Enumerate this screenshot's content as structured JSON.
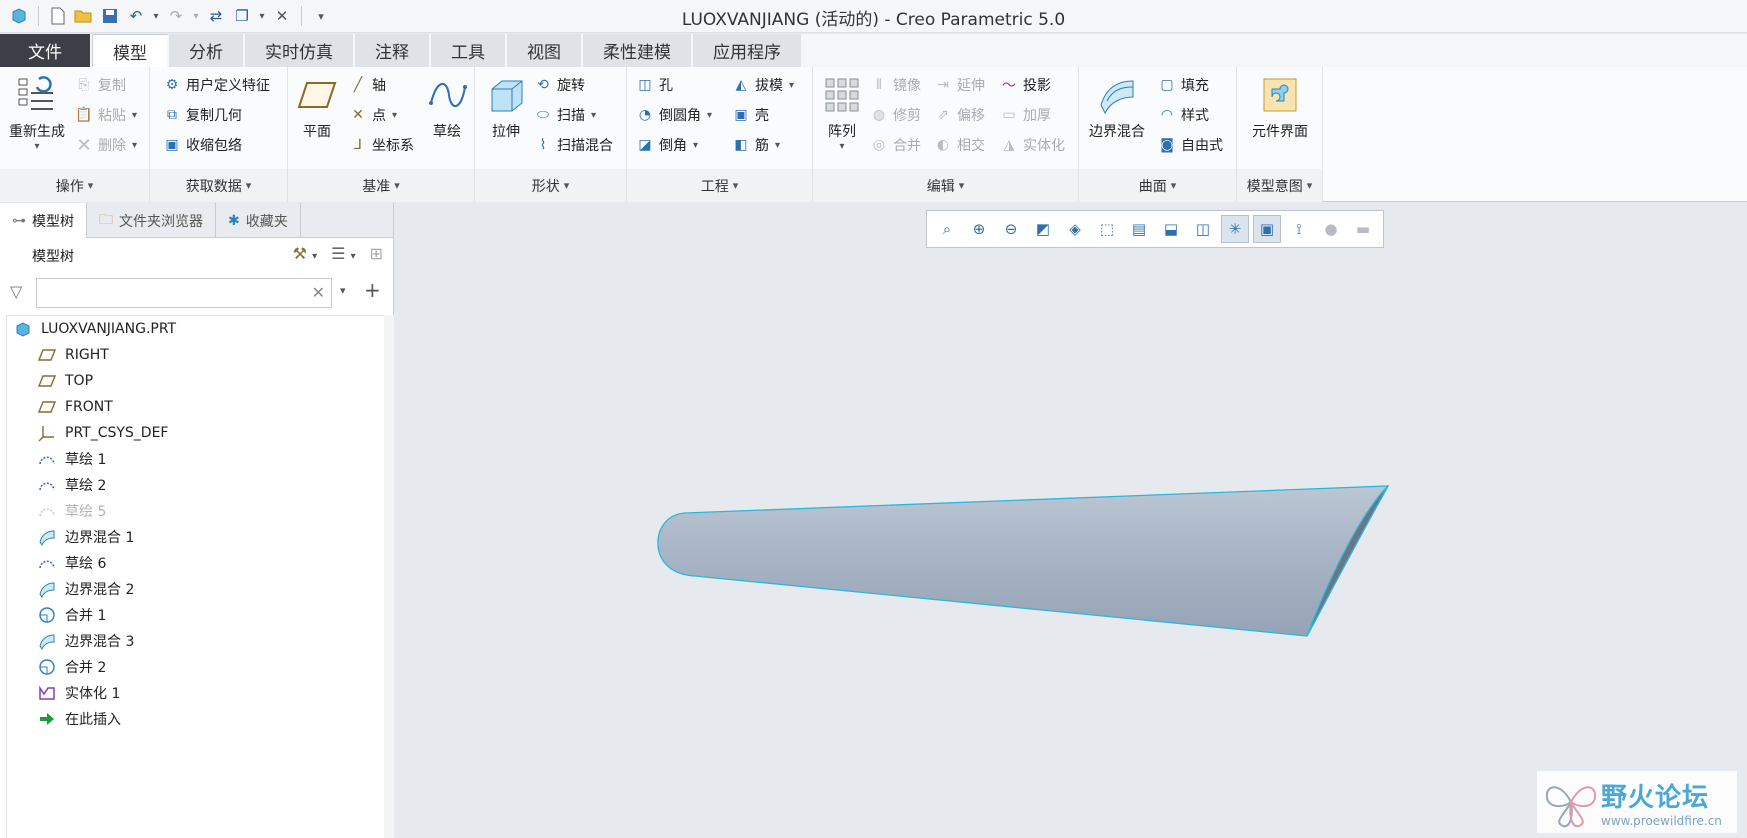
{
  "window": {
    "title": "LUOXVANJIANG (活动的) - Creo Parametric 5.0"
  },
  "qat": {
    "icons": [
      "app-icon",
      "new-icon",
      "open-icon",
      "save-icon",
      "undo-icon",
      "redo-icon",
      "regenerate-icon",
      "windows-icon",
      "close-icon",
      "customize-icon"
    ]
  },
  "tabs": [
    "文件",
    "模型",
    "分析",
    "实时仿真",
    "注释",
    "工具",
    "视图",
    "柔性建模",
    "应用程序"
  ],
  "active_tab": "模型",
  "ribbon": {
    "operations": {
      "label": "操作",
      "regenerate": "重新生成",
      "copy": "复制",
      "paste": "粘贴",
      "delete": "删除"
    },
    "get_data": {
      "label": "获取数据",
      "udf": "用户定义特征",
      "copy_geom": "复制几何",
      "shrinkwrap": "收缩包络"
    },
    "datum": {
      "label": "基准",
      "plane": "平面",
      "axis": "轴",
      "point": "点",
      "csys": "坐标系",
      "sketch": "草绘"
    },
    "shapes": {
      "label": "形状",
      "extrude": "拉伸",
      "revolve": "旋转",
      "sweep": "扫描",
      "swept_blend": "扫描混合"
    },
    "engineering": {
      "label": "工程",
      "hole": "孔",
      "round": "倒圆角",
      "chamfer": "倒角",
      "draft": "拔模",
      "shell": "壳",
      "rib": "筋"
    },
    "editing": {
      "label": "编辑",
      "pattern": "阵列",
      "mirror": "镜像",
      "trim": "修剪",
      "merge": "合并",
      "extend": "延伸",
      "offset": "偏移",
      "intersect": "相交",
      "project": "投影",
      "thicken": "加厚",
      "solidify": "实体化"
    },
    "surfaces": {
      "label": "曲面",
      "boundary_blend": "边界混合",
      "fill": "填充",
      "style": "样式",
      "freestyle": "自由式"
    },
    "model_intent": {
      "label": "模型意图",
      "component_interface": "元件界面"
    }
  },
  "panel": {
    "tabs": [
      "模型树",
      "文件夹浏览器",
      "收藏夹"
    ],
    "header": "模型树",
    "search": {
      "value": "",
      "placeholder": ""
    }
  },
  "tree": [
    {
      "label": "LUOXVANJIANG.PRT",
      "icon": "part-icon",
      "level": 0,
      "dim": false
    },
    {
      "label": "RIGHT",
      "icon": "datum-plane-icon",
      "level": 1,
      "dim": false
    },
    {
      "label": "TOP",
      "icon": "datum-plane-icon",
      "level": 1,
      "dim": false
    },
    {
      "label": "FRONT",
      "icon": "datum-plane-icon",
      "level": 1,
      "dim": false
    },
    {
      "label": "PRT_CSYS_DEF",
      "icon": "csys-icon",
      "level": 1,
      "dim": false
    },
    {
      "label": "草绘 1",
      "icon": "sketch-icon",
      "level": 1,
      "dim": false
    },
    {
      "label": "草绘 2",
      "icon": "sketch-icon",
      "level": 1,
      "dim": false
    },
    {
      "label": "草绘 5",
      "icon": "sketch-icon",
      "level": 1,
      "dim": true
    },
    {
      "label": "边界混合 1",
      "icon": "boundary-blend-icon",
      "level": 1,
      "dim": false
    },
    {
      "label": "草绘 6",
      "icon": "sketch-icon",
      "level": 1,
      "dim": false
    },
    {
      "label": "边界混合 2",
      "icon": "boundary-blend-icon",
      "level": 1,
      "dim": false
    },
    {
      "label": "合并 1",
      "icon": "merge-icon",
      "level": 1,
      "dim": false
    },
    {
      "label": "边界混合 3",
      "icon": "boundary-blend-icon",
      "level": 1,
      "dim": false
    },
    {
      "label": "合并 2",
      "icon": "merge-icon",
      "level": 1,
      "dim": false
    },
    {
      "label": "实体化 1",
      "icon": "solidify-icon",
      "level": 1,
      "dim": false
    },
    {
      "label": "在此插入",
      "icon": "insert-here-icon",
      "level": 1,
      "dim": false
    }
  ],
  "graphics_toolbar": [
    "refit-icon",
    "zoom-in-icon",
    "zoom-out-icon",
    "repaint-icon",
    "display-style-icon",
    "saved-orientations-icon",
    "view-manager-icon",
    "perspective-icon",
    "section-icon",
    "datum-display-icon",
    "annotation-display-icon",
    "spin-center-icon",
    "appearance-icon",
    "light-icon"
  ],
  "watermark": {
    "name": "野火论坛",
    "url": "www.proewildfire.cn"
  },
  "colors": {
    "model_fill": "#a9b6c7",
    "model_edge": "#2ab8d8",
    "file_tab": "#3c4046",
    "viewport_bg": "#e6e9ee"
  }
}
